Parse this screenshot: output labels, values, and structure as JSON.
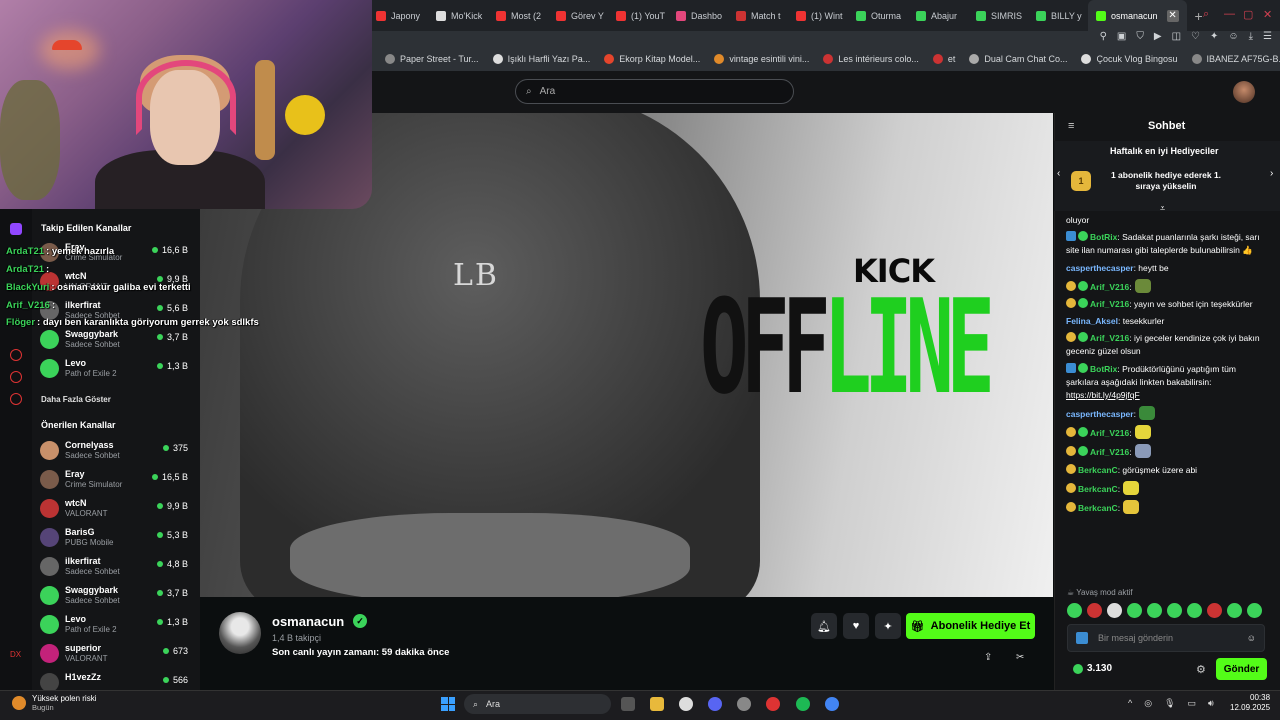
{
  "browser": {
    "tabs": [
      {
        "label": "Japony",
        "color": "#e33"
      },
      {
        "label": "Mo'Kick",
        "color": "#ddd"
      },
      {
        "label": "Most (2",
        "color": "#e33"
      },
      {
        "label": "Görev Y",
        "color": "#e33"
      },
      {
        "label": "(1) YouT",
        "color": "#e33"
      },
      {
        "label": "Dashbo",
        "color": "#e3477c"
      },
      {
        "label": "Match t",
        "color": "#c33"
      },
      {
        "label": "(1) Wint",
        "color": "#e33"
      },
      {
        "label": "Oturma",
        "color": "#3bd35a"
      },
      {
        "label": "Abajur",
        "color": "#3bd35a"
      },
      {
        "label": "SIMRIS",
        "color": "#3bd35a"
      },
      {
        "label": "BILLY y",
        "color": "#3bd35a"
      }
    ],
    "active_tab": {
      "label": "osmanacun",
      "color": "#53fc18"
    },
    "new_tab": "+",
    "bookmarks": [
      {
        "label": "Paper Street - Tur...",
        "color": "#888"
      },
      {
        "label": "Işıklı Harfli Yazı Pa...",
        "color": "#ddd"
      },
      {
        "label": "Ekorp Kitap Model...",
        "color": "#e5452c"
      },
      {
        "label": "vintage esintili vini...",
        "color": "#e08a2a"
      },
      {
        "label": "Les intérieurs colo...",
        "color": "#c33"
      },
      {
        "label": "et",
        "color": "#c33"
      },
      {
        "label": "Dual Cam Chat Co...",
        "color": "#aaa"
      },
      {
        "label": "Çocuk Vlog Bingosu",
        "color": "#ddd"
      },
      {
        "label": "IBANEZ AF75G-B...",
        "color": "#888"
      }
    ],
    "bookmark_partial": "ta..."
  },
  "search": {
    "placeholder": "Ara"
  },
  "sidebar": {
    "followed_title": "Takip Edilen Kanallar",
    "followed": [
      {
        "name": "Eray",
        "game": "Crime Simulator",
        "viewers": "16,6 B",
        "color": "#7a5b4a"
      },
      {
        "name": "wtcN",
        "game": "VALORANT",
        "viewers": "9,9 B",
        "color": "#b33"
      },
      {
        "name": "ilkerfirat",
        "game": "Sadece Sohbet",
        "viewers": "5,6 B",
        "color": "#666"
      },
      {
        "name": "Swaggybark",
        "game": "Sadece Sohbet",
        "viewers": "3,7 B",
        "color": "#3bd35a"
      },
      {
        "name": "Levo",
        "game": "Path of Exile 2",
        "viewers": "1,3 B",
        "color": "#3bd35a"
      }
    ],
    "show_more": "Daha Fazla Göster",
    "recommended_title": "Önerilen Kanallar",
    "recommended": [
      {
        "name": "Cornelyass",
        "game": "Sadece Sohbet",
        "viewers": "375",
        "color": "#c8906a"
      },
      {
        "name": "Eray",
        "game": "Crime Simulator",
        "viewers": "16,5 B",
        "color": "#7a5b4a"
      },
      {
        "name": "wtcN",
        "game": "VALORANT",
        "viewers": "9,9 B",
        "color": "#b33"
      },
      {
        "name": "BarisG",
        "game": "PUBG Mobile",
        "viewers": "5,3 B",
        "color": "#554477"
      },
      {
        "name": "ilkerfirat",
        "game": "Sadece Sohbet",
        "viewers": "4,8 B",
        "color": "#666"
      },
      {
        "name": "Swaggybark",
        "game": "Sadece Sohbet",
        "viewers": "3,7 B",
        "color": "#3bd35a"
      },
      {
        "name": "Levo",
        "game": "Path of Exile 2",
        "viewers": "1,3 B",
        "color": "#3bd35a"
      },
      {
        "name": "superior",
        "game": "VALORANT",
        "viewers": "673",
        "color": "#c3227a"
      },
      {
        "name": "H1vezZz",
        "game": "",
        "viewers": "566",
        "color": "#444"
      }
    ]
  },
  "overlay_chat": [
    {
      "user": "ArdaT21",
      "text": ": yemek hazırla",
      "color": "#3bd35a"
    },
    {
      "user": "ArdaT21",
      "text": ":",
      "color": "#3bd35a"
    },
    {
      "user": "BlackYuri",
      "text": ": osman axur galiba evi terketti",
      "color": "#3bd35a"
    },
    {
      "user": "Arif_V216",
      "text": ":",
      "color": "#3bd35a"
    },
    {
      "user": "Flöger",
      "text": ": dayı ben karanlıkta göriyorum gerrek yok sdlkfs",
      "color": "#3bd35a"
    }
  ],
  "video": {
    "brand": "KICK",
    "status_off": "OFF",
    "status_line": "LINE",
    "shirt_logo": "LB"
  },
  "channel": {
    "name": "osmanacun",
    "verified": "✓",
    "followers": "1,4 B takipçi",
    "last_stream": "Son canlı yayın zamanı: 59 dakika önce",
    "gift_button": "Abonelik Hediye Et"
  },
  "chat": {
    "title": "Sohbet",
    "gifters_title": "Haftalık en iyi Hediyeciler",
    "gifters_badge": "1",
    "gifters_text": "1 abonelik hediye ederek 1. sıraya yükselin",
    "messages": [
      {
        "user": "",
        "text": "oluyor",
        "badge": "",
        "ucolor": "#fff"
      },
      {
        "user": "BotRix",
        "text": ": Sadakat puanlarınla şarkı isteği, sarı site ilan numarası gibi taleplerde bulunabilirsin 👍",
        "badge": "bg",
        "ucolor": "#3bd35a"
      },
      {
        "user": "casperthecasper",
        "text": ": heytt be",
        "badge": "",
        "ucolor": "#7ab8ff"
      },
      {
        "user": "Arif_V216",
        "text": ":",
        "badge": "yg",
        "ucolor": "#3bd35a",
        "emote": "#6b8a3a"
      },
      {
        "user": "Arif_V216",
        "text": ": yayın ve sohbet için teşekkürler",
        "badge": "yg",
        "ucolor": "#3bd35a"
      },
      {
        "user": "Felina_Aksel",
        "text": ": tesekkurler",
        "badge": "",
        "ucolor": "#7ab8ff"
      },
      {
        "user": "Arif_V216",
        "text": ": iyi geceler kendinize çok iyi bakın geceniz güzel olsun",
        "badge": "yg",
        "ucolor": "#3bd35a"
      },
      {
        "user": "BotRix",
        "text": ": Prodüktörlüğünü yaptığım tüm şarkılara aşağıdaki linkten bakabilirsin:",
        "badge": "bg",
        "ucolor": "#3bd35a",
        "link": "https://bit.ly/4p9jfqF"
      },
      {
        "user": "casperthecasper",
        "text": ":",
        "badge": "",
        "ucolor": "#7ab8ff",
        "emote": "#3a8a3a"
      },
      {
        "user": "Arif_V216",
        "text": ":",
        "badge": "yg",
        "ucolor": "#3bd35a",
        "emote": "#e5d53b"
      },
      {
        "user": "Arif_V216",
        "text": ":",
        "badge": "yg",
        "ucolor": "#3bd35a",
        "emote": "#8a9ab8"
      },
      {
        "user": "BerkcanC",
        "text": ": görüşmek üzere abi",
        "badge": "y",
        "ucolor": "#3bd35a"
      },
      {
        "user": "BerkcanC",
        "text": ":",
        "badge": "y",
        "ucolor": "#3bd35a",
        "emote": "#e5d53b"
      },
      {
        "user": "BerkcanC",
        "text": ":",
        "badge": "y",
        "ucolor": "#3bd35a",
        "emote": "#e5c53b"
      }
    ],
    "slow_mode": "Yavaş mod aktif",
    "input_placeholder": "Bir mesaj gönderin",
    "points": "3.130",
    "send_label": "Gönder",
    "emoji_colors": [
      "#3bd35a",
      "#c33",
      "#ddd",
      "#3bd35a",
      "#3bd35a",
      "#3bd35a",
      "#3bd35a",
      "#c33",
      "#3bd35a",
      "#3bd35a"
    ]
  },
  "taskbar": {
    "weather_title": "Yüksek polen riski",
    "weather_sub": "Bugün",
    "search": "Ara",
    "time": "00:38",
    "date": "12.09.2025"
  }
}
